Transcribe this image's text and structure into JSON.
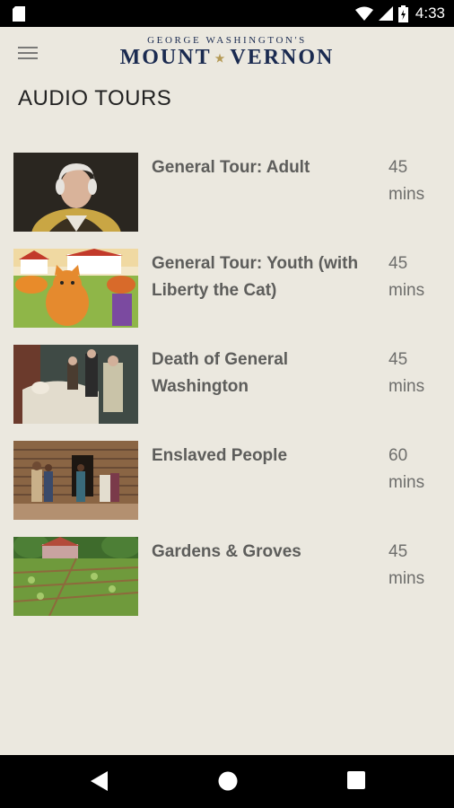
{
  "status_bar": {
    "time": "4:33"
  },
  "header": {
    "logo_small": "GEORGE WASHINGTON'S",
    "logo_word1": "MOUNT",
    "logo_word2": "VERNON"
  },
  "page_title": "AUDIO TOURS",
  "tours": [
    {
      "name": "General Tour: Adult",
      "duration_value": "45",
      "duration_unit": "mins"
    },
    {
      "name": "General Tour: Youth (with Liberty the Cat)",
      "duration_value": "45",
      "duration_unit": "mins"
    },
    {
      "name": "Death of General Washington",
      "duration_value": "45",
      "duration_unit": "mins"
    },
    {
      "name": "Enslaved People",
      "duration_value": "60",
      "duration_unit": "mins"
    },
    {
      "name": "Gardens & Groves",
      "duration_value": "45",
      "duration_unit": "mins"
    }
  ],
  "colors": {
    "background": "#ebe8df",
    "logo_navy": "#1a2a50",
    "logo_gold": "#b59a55"
  },
  "icons": {
    "menu": "hamburger-icon",
    "back": "back-icon",
    "home": "home-icon",
    "recents": "recents-icon"
  }
}
